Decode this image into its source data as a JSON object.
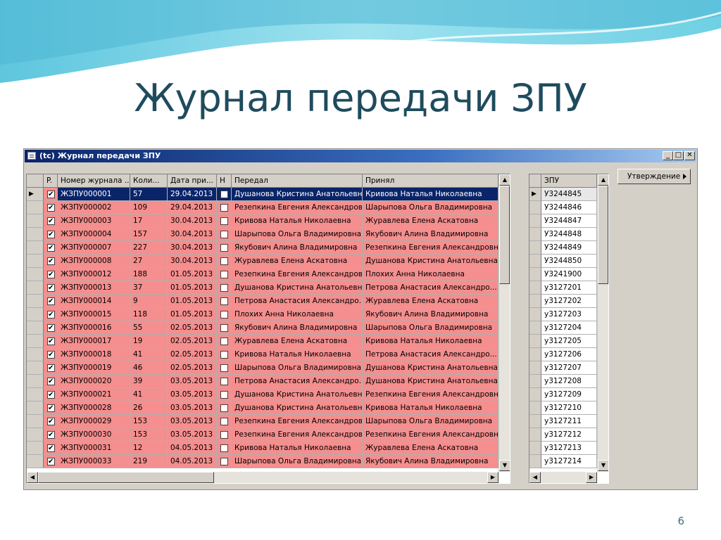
{
  "slide": {
    "title": "Журнал передачи ЗПУ",
    "page_number": "6"
  },
  "window": {
    "title": "(tc) Журнал передачи ЗПУ",
    "minimize": "_",
    "maximize": "□",
    "close": "✕"
  },
  "actions": {
    "approve_label": "Утверждение"
  },
  "colors": {
    "row_pink": "#f58e8e",
    "selected": "#0a246a",
    "title": "#1f4b5e"
  },
  "journal": {
    "columns": [
      "P.",
      "Номер журнала ...",
      "Коли...",
      "Дата при...",
      "Н",
      "Передал",
      "Принял"
    ],
    "rows": [
      {
        "checked": true,
        "number": "ЖЗПУ000001",
        "qty": "57",
        "date": "29.04.2013",
        "n": false,
        "passed_by": "Душанова Кристина Анатольевна",
        "received_by": "Кривова Наталья Николаевна"
      },
      {
        "checked": true,
        "number": "ЖЗПУ000002",
        "qty": "109",
        "date": "29.04.2013",
        "n": false,
        "passed_by": "Резепкина Евгения Александровна",
        "received_by": "Шарыпова Ольга Владимировна"
      },
      {
        "checked": true,
        "number": "ЖЗПУ000003",
        "qty": "17",
        "date": "30.04.2013",
        "n": false,
        "passed_by": "Кривова Наталья Николаевна",
        "received_by": "Журавлева Елена Аскатовна"
      },
      {
        "checked": true,
        "number": "ЖЗПУ000004",
        "qty": "157",
        "date": "30.04.2013",
        "n": false,
        "passed_by": "Шарыпова Ольга Владимировна",
        "received_by": "Якубович Алина Владимировна"
      },
      {
        "checked": true,
        "number": "ЖЗПУ000007",
        "qty": "227",
        "date": "30.04.2013",
        "n": false,
        "passed_by": "Якубович Алина Владимировна",
        "received_by": "Резепкина Евгения Александровна"
      },
      {
        "checked": true,
        "number": "ЖЗПУ000008",
        "qty": "27",
        "date": "30.04.2013",
        "n": false,
        "passed_by": "Журавлева Елена Аскатовна",
        "received_by": "Душанова Кристина Анатольевна"
      },
      {
        "checked": true,
        "number": "ЖЗПУ000012",
        "qty": "188",
        "date": "01.05.2013",
        "n": false,
        "passed_by": "Резепкина Евгения Александровна",
        "received_by": "Плохих Анна Николаевна"
      },
      {
        "checked": true,
        "number": "ЖЗПУ000013",
        "qty": "37",
        "date": "01.05.2013",
        "n": false,
        "passed_by": "Душанова Кристина Анатольевна",
        "received_by": "Петрова Анастасия Александро..."
      },
      {
        "checked": true,
        "number": "ЖЗПУ000014",
        "qty": "9",
        "date": "01.05.2013",
        "n": false,
        "passed_by": "Петрова Анастасия Александро...",
        "received_by": "Журавлева Елена Аскатовна"
      },
      {
        "checked": true,
        "number": "ЖЗПУ000015",
        "qty": "118",
        "date": "01.05.2013",
        "n": false,
        "passed_by": "Плохих Анна Николаевна",
        "received_by": "Якубович Алина Владимировна"
      },
      {
        "checked": true,
        "number": "ЖЗПУ000016",
        "qty": "55",
        "date": "02.05.2013",
        "n": false,
        "passed_by": "Якубович Алина Владимировна",
        "received_by": "Шарыпова Ольга Владимировна"
      },
      {
        "checked": true,
        "number": "ЖЗПУ000017",
        "qty": "19",
        "date": "02.05.2013",
        "n": false,
        "passed_by": "Журавлева Елена Аскатовна",
        "received_by": "Кривова Наталья Николаевна"
      },
      {
        "checked": true,
        "number": "ЖЗПУ000018",
        "qty": "41",
        "date": "02.05.2013",
        "n": false,
        "passed_by": "Кривова Наталья Николаевна",
        "received_by": "Петрова Анастасия Александро..."
      },
      {
        "checked": true,
        "number": "ЖЗПУ000019",
        "qty": "46",
        "date": "02.05.2013",
        "n": false,
        "passed_by": "Шарыпова Ольга Владимировна",
        "received_by": "Душанова Кристина Анатольевна"
      },
      {
        "checked": true,
        "number": "ЖЗПУ000020",
        "qty": "39",
        "date": "03.05.2013",
        "n": false,
        "passed_by": "Петрова Анастасия Александро...",
        "received_by": "Душанова Кристина Анатольевна"
      },
      {
        "checked": true,
        "number": "ЖЗПУ000021",
        "qty": "41",
        "date": "03.05.2013",
        "n": false,
        "passed_by": "Душанова Кристина Анатольевна",
        "received_by": "Резепкина Евгения Александровна"
      },
      {
        "checked": true,
        "number": "ЖЗПУ000028",
        "qty": "26",
        "date": "03.05.2013",
        "n": false,
        "passed_by": "Душанова Кристина Анатольевна",
        "received_by": "Кривова Наталья Николаевна"
      },
      {
        "checked": true,
        "number": "ЖЗПУ000029",
        "qty": "153",
        "date": "03.05.2013",
        "n": false,
        "passed_by": "Резепкина Евгения Александровна",
        "received_by": "Шарыпова Ольга Владимировна"
      },
      {
        "checked": true,
        "number": "ЖЗПУ000030",
        "qty": "153",
        "date": "03.05.2013",
        "n": false,
        "passed_by": "Резепкина Евгения Александровна",
        "received_by": "Резепкина Евгения Александровна"
      },
      {
        "checked": true,
        "number": "ЖЗПУ000031",
        "qty": "12",
        "date": "04.05.2013",
        "n": false,
        "passed_by": "Кривова Наталья Николаевна",
        "received_by": "Журавлева Елена Аскатовна"
      },
      {
        "checked": true,
        "number": "ЖЗПУ000033",
        "qty": "219",
        "date": "04.05.2013",
        "n": false,
        "passed_by": "Шарыпова Ольга Владимировна",
        "received_by": "Якубович Алина Владимировна"
      }
    ]
  },
  "zpu": {
    "column": "ЗПУ",
    "items": [
      "У3244845",
      "У3244846",
      "У3244847",
      "У3244848",
      "У3244849",
      "У3244850",
      "У3241900",
      "у3127201",
      "у3127202",
      "у3127203",
      "у3127204",
      "у3127205",
      "у3127206",
      "у3127207",
      "у3127208",
      "у3127209",
      "у3127210",
      "у3127211",
      "у3127212",
      "у3127213",
      "у3127214"
    ]
  },
  "icons": {
    "row_pointer": "triangle-right-icon",
    "scroll_up": "arrow-up-icon",
    "scroll_down": "arrow-down-icon",
    "scroll_left": "arrow-left-icon",
    "scroll_right": "arrow-right-icon"
  }
}
